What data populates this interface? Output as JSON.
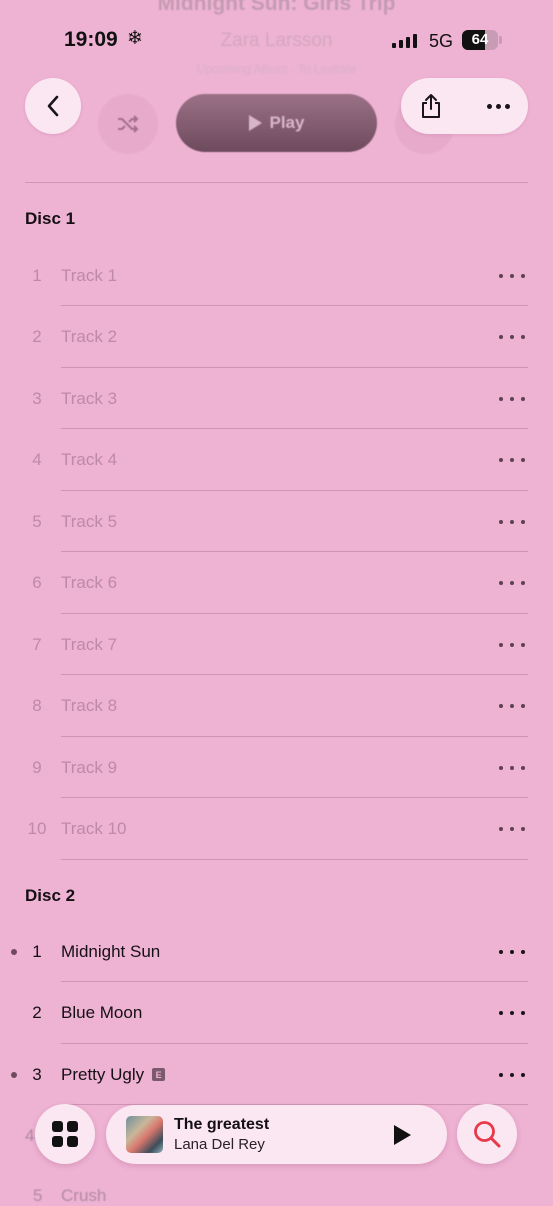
{
  "status": {
    "time": "19:09",
    "network": "5G",
    "battery": "64",
    "battery_level": 0.64
  },
  "album": {
    "title": "Midnight Sun: Girls Trip",
    "artist": "Zara Larsson",
    "subtitle": "Upcoming Album · To Levitate"
  },
  "actions": {
    "play_label": "Play"
  },
  "discs": [
    {
      "label": "Disc 1",
      "tracks": [
        {
          "num": "1",
          "title": "Track 1"
        },
        {
          "num": "2",
          "title": "Track 2"
        },
        {
          "num": "3",
          "title": "Track 3"
        },
        {
          "num": "4",
          "title": "Track 4"
        },
        {
          "num": "5",
          "title": "Track 5"
        },
        {
          "num": "6",
          "title": "Track 6"
        },
        {
          "num": "7",
          "title": "Track 7"
        },
        {
          "num": "8",
          "title": "Track 8"
        },
        {
          "num": "9",
          "title": "Track 9"
        },
        {
          "num": "10",
          "title": "Track 10"
        }
      ]
    },
    {
      "label": "Disc 2",
      "tracks": [
        {
          "num": "1",
          "title": "Midnight Sun"
        },
        {
          "num": "2",
          "title": "Blue Moon"
        },
        {
          "num": "3",
          "title": "Pretty Ugly",
          "explicit": "E"
        },
        {
          "num": "5",
          "title": "Crush"
        }
      ]
    }
  ],
  "now_playing": {
    "title": "The greatest",
    "artist": "Lana Del Rey"
  },
  "icons": {
    "back": "chevron-left-icon",
    "shuffle": "shuffle-icon",
    "share": "share-icon",
    "more": "ellipsis-icon",
    "library": "grid-icon",
    "search": "search-icon",
    "playback": "play-icon",
    "status": "snowflake-icon"
  },
  "colors": {
    "background": "#eeb2d3",
    "accent_search": "#e8394a",
    "button_bg": "#fbe7f2"
  }
}
